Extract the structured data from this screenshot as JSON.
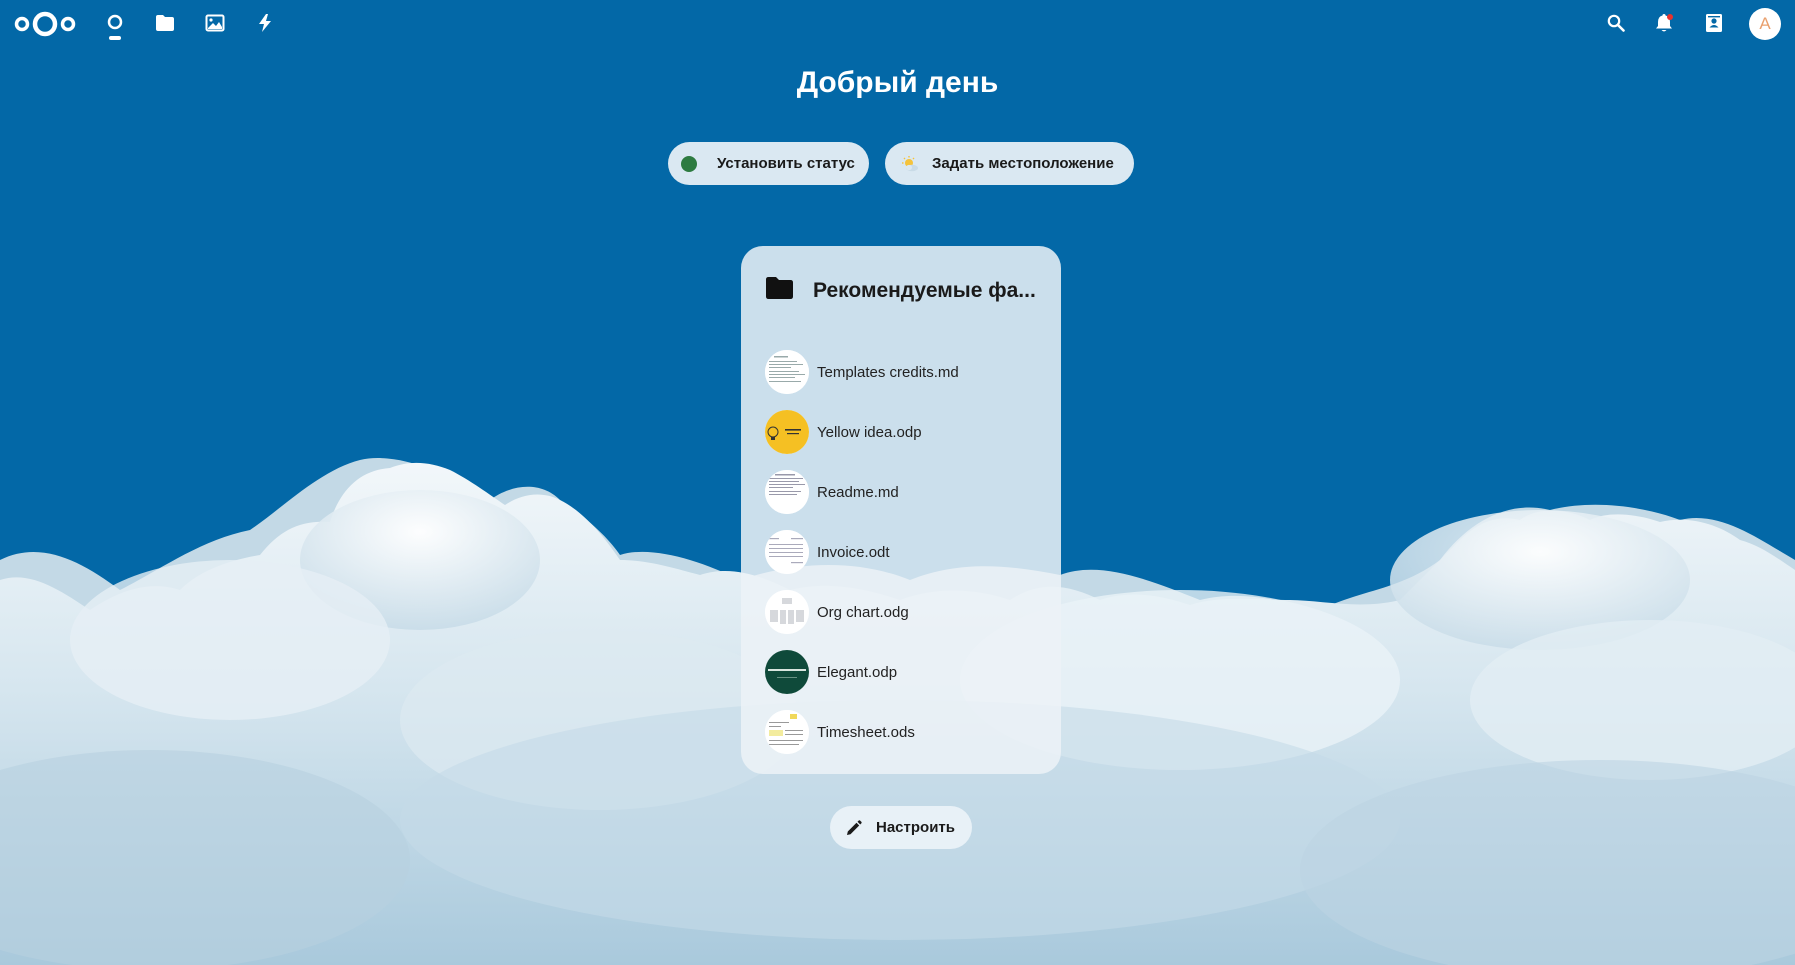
{
  "header": {
    "logo": "nextcloud-logo",
    "nav": [
      {
        "name": "dashboard",
        "icon": "dashboard-icon"
      },
      {
        "name": "files",
        "icon": "folder-icon"
      },
      {
        "name": "photos",
        "icon": "image-icon"
      },
      {
        "name": "activity",
        "icon": "lightning-icon"
      }
    ],
    "right": [
      {
        "name": "search",
        "icon": "search-icon"
      },
      {
        "name": "notifications",
        "icon": "bell-icon"
      },
      {
        "name": "contacts",
        "icon": "contacts-icon"
      }
    ],
    "avatar_letter": "A"
  },
  "greeting": "Добрый день",
  "status_button": "Установить статус",
  "location_button": "Задать местоположение",
  "widget": {
    "title": "Рекомендуемые фа...",
    "files": [
      {
        "name": "Templates credits.md",
        "thumb": "text-doc"
      },
      {
        "name": "Yellow idea.odp",
        "thumb": "yellow-slide"
      },
      {
        "name": "Readme.md",
        "thumb": "text-doc"
      },
      {
        "name": "Invoice.odt",
        "thumb": "invoice-doc"
      },
      {
        "name": "Org chart.odg",
        "thumb": "org-chart"
      },
      {
        "name": "Elegant.odp",
        "thumb": "elegant-slide"
      },
      {
        "name": "Timesheet.ods",
        "thumb": "spreadsheet"
      }
    ]
  },
  "customize_button": "Настроить",
  "colors": {
    "background": "#0368a7",
    "status_online": "#2d7b41",
    "avatar_text": "#e9a06e"
  }
}
